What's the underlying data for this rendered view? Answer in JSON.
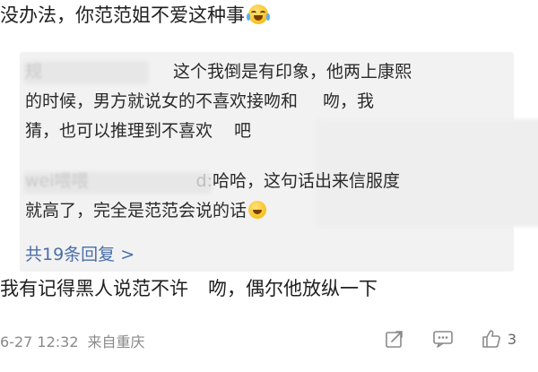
{
  "top_comment": {
    "text": "没办法，你范范姐不爱这种事"
  },
  "replies": {
    "reply1": {
      "username_blurred": "规",
      "part1": "这个我倒是有印象，他两上康熙",
      "part2": "的时候，男方就说女的不喜欢接吻和",
      "part3": "吻，我",
      "part4": "猜，也可以推理到不喜欢",
      "part5": "吧"
    },
    "reply2": {
      "username_blurred": "wei喂喂",
      "username_suffix": "d:",
      "part1": "哈哈，这句话出来信服度",
      "part2": "就高了，完全是范范会说的话"
    },
    "more_label": "共19条回复",
    "more_chevron": ">"
  },
  "bottom_comment": {
    "part1": "我有记得黑人说范不许",
    "part2": "吻，偶尔他放纵一下"
  },
  "meta": {
    "time": "6-27 12:32",
    "location": "来自重庆"
  },
  "actions": {
    "like_count": "3"
  },
  "colors": {
    "link": "#4a6ea9",
    "reply_bg": "#f2f2f2",
    "meta_text": "#8a8a8a"
  }
}
